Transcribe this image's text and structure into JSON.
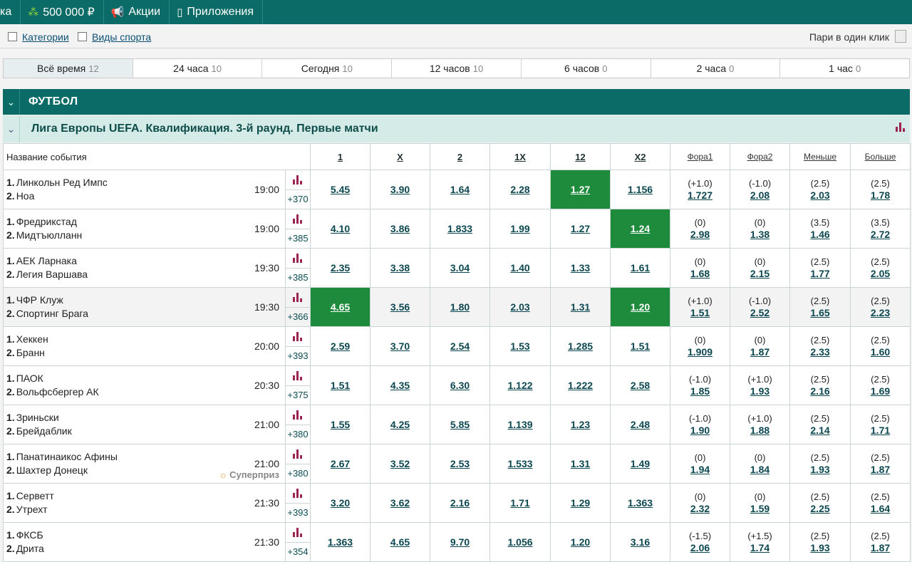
{
  "topbar": {
    "partial": "ка",
    "bonus": "500 000 ₽",
    "promo": "Акции",
    "apps": "Приложения"
  },
  "filters": {
    "categories": "Категории",
    "sports": "Виды спорта",
    "oneclick": "Пари в один клик"
  },
  "timetabs": [
    {
      "label": "Всё время",
      "count": "12"
    },
    {
      "label": "24 часа",
      "count": "10"
    },
    {
      "label": "Сегодня",
      "count": "10"
    },
    {
      "label": "12 часов",
      "count": "10"
    },
    {
      "label": "6 часов",
      "count": "0"
    },
    {
      "label": "2 часа",
      "count": "0"
    },
    {
      "label": "1 час",
      "count": "0"
    }
  ],
  "sport": {
    "title": "ФУТБОЛ"
  },
  "league": {
    "title": "Лига Европы UEFA. Квалификация. 3-й раунд. Первые матчи"
  },
  "columns": {
    "name": "Название события",
    "c1": "1",
    "cx": "X",
    "c2": "2",
    "c1x": "1X",
    "c12": "12",
    "cx2": "X2",
    "fora1": "Фора1",
    "fora2": "Фора2",
    "less": "Меньше",
    "more": "Больше"
  },
  "events": [
    {
      "n1": "1.",
      "t1": "Линкольн Ред Импс",
      "n2": "2.",
      "t2": "Ноа",
      "time": "19:00",
      "plus": "+370",
      "o1": "5.45",
      "ox": "3.90",
      "o2": "1.64",
      "o1x": "2.28",
      "o12": "1.27",
      "ox2": "1.156",
      "h1": "(+1.0)",
      "h1o": "1.727",
      "h2": "(-1.0)",
      "h2o": "2.08",
      "tl": "(2.5)",
      "tlo": "2.03",
      "tm": "(2.5)",
      "tmo": "1.78"
    },
    {
      "n1": "1.",
      "t1": "Фредрикстад",
      "n2": "2.",
      "t2": "Мидтъюлланн",
      "time": "19:00",
      "plus": "+385",
      "o1": "4.10",
      "ox": "3.86",
      "o2": "1.833",
      "o1x": "1.99",
      "o12": "1.27",
      "ox2": "1.24",
      "h1": "(0)",
      "h1o": "2.98",
      "h2": "(0)",
      "h2o": "1.38",
      "tl": "(3.5)",
      "tlo": "1.46",
      "tm": "(3.5)",
      "tmo": "2.72"
    },
    {
      "n1": "1.",
      "t1": "АЕК Ларнака",
      "n2": "2.",
      "t2": "Легия Варшава",
      "time": "19:30",
      "plus": "+385",
      "o1": "2.35",
      "ox": "3.38",
      "o2": "3.04",
      "o1x": "1.40",
      "o12": "1.33",
      "ox2": "1.61",
      "h1": "(0)",
      "h1o": "1.68",
      "h2": "(0)",
      "h2o": "2.15",
      "tl": "(2.5)",
      "tlo": "1.77",
      "tm": "(2.5)",
      "tmo": "2.05"
    },
    {
      "n1": "1.",
      "t1": "ЧФР Клуж",
      "n2": "2.",
      "t2": "Спортинг Брага",
      "time": "19:30",
      "plus": "+366",
      "o1": "4.65",
      "ox": "3.56",
      "o2": "1.80",
      "o1x": "2.03",
      "o12": "1.31",
      "ox2": "1.20",
      "h1": "(+1.0)",
      "h1o": "1.51",
      "h2": "(-1.0)",
      "h2o": "2.52",
      "tl": "(2.5)",
      "tlo": "1.65",
      "tm": "(2.5)",
      "tmo": "2.23"
    },
    {
      "n1": "1.",
      "t1": "Хеккен",
      "n2": "2.",
      "t2": "Бранн",
      "time": "20:00",
      "plus": "+393",
      "o1": "2.59",
      "ox": "3.70",
      "o2": "2.54",
      "o1x": "1.53",
      "o12": "1.285",
      "ox2": "1.51",
      "h1": "(0)",
      "h1o": "1.909",
      "h2": "(0)",
      "h2o": "1.87",
      "tl": "(2.5)",
      "tlo": "2.33",
      "tm": "(2.5)",
      "tmo": "1.60"
    },
    {
      "n1": "1.",
      "t1": "ПАОК",
      "n2": "2.",
      "t2": "Вольфсбергер АК",
      "time": "20:30",
      "plus": "+375",
      "o1": "1.51",
      "ox": "4.35",
      "o2": "6.30",
      "o1x": "1.122",
      "o12": "1.222",
      "ox2": "2.58",
      "h1": "(-1.0)",
      "h1o": "1.85",
      "h2": "(+1.0)",
      "h2o": "1.93",
      "tl": "(2.5)",
      "tlo": "2.16",
      "tm": "(2.5)",
      "tmo": "1.69"
    },
    {
      "n1": "1.",
      "t1": "Зриньски",
      "n2": "2.",
      "t2": "Брейдаблик",
      "time": "21:00",
      "plus": "+380",
      "o1": "1.55",
      "ox": "4.25",
      "o2": "5.85",
      "o1x": "1.139",
      "o12": "1.23",
      "ox2": "2.48",
      "h1": "(-1.0)",
      "h1o": "1.90",
      "h2": "(+1.0)",
      "h2o": "1.88",
      "tl": "(2.5)",
      "tlo": "2.14",
      "tm": "(2.5)",
      "tmo": "1.71"
    },
    {
      "n1": "1.",
      "t1": "Панатинаикос Афины",
      "n2": "2.",
      "t2": "Шахтер Донецк",
      "time": "21:00",
      "plus": "+380",
      "sp": "Суперприз",
      "o1": "2.67",
      "ox": "3.52",
      "o2": "2.53",
      "o1x": "1.533",
      "o12": "1.31",
      "ox2": "1.49",
      "h1": "(0)",
      "h1o": "1.94",
      "h2": "(0)",
      "h2o": "1.84",
      "tl": "(2.5)",
      "tlo": "1.93",
      "tm": "(2.5)",
      "tmo": "1.87"
    },
    {
      "n1": "1.",
      "t1": "Серветт",
      "n2": "2.",
      "t2": "Утрехт",
      "time": "21:30",
      "plus": "+393",
      "o1": "3.20",
      "ox": "3.62",
      "o2": "2.16",
      "o1x": "1.71",
      "o12": "1.29",
      "ox2": "1.363",
      "h1": "(0)",
      "h1o": "2.32",
      "h2": "(0)",
      "h2o": "1.59",
      "tl": "(2.5)",
      "tlo": "2.25",
      "tm": "(2.5)",
      "tmo": "1.64"
    },
    {
      "n1": "1.",
      "t1": "ФКСБ",
      "n2": "2.",
      "t2": "Дрита",
      "time": "21:30",
      "plus": "+354",
      "o1": "1.363",
      "ox": "4.65",
      "o2": "9.70",
      "o1x": "1.056",
      "o12": "1.20",
      "ox2": "3.16",
      "h1": "(-1.5)",
      "h1o": "2.06",
      "h2": "(+1.5)",
      "h2o": "1.74",
      "tl": "(2.5)",
      "tlo": "1.93",
      "tm": "(2.5)",
      "tmo": "1.87"
    }
  ],
  "colors": {
    "brand": "#0a6b67",
    "selected": "#1e8a3c",
    "league_bg": "#d5ebe8",
    "stat_icon": "#9b2452"
  }
}
